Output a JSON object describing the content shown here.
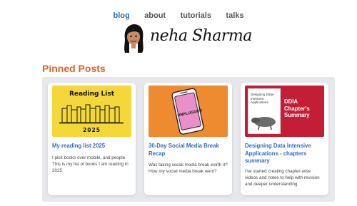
{
  "nav": {
    "items": [
      {
        "label": "blog",
        "active": true
      },
      {
        "label": "about"
      },
      {
        "label": "tutorials"
      },
      {
        "label": "talks"
      }
    ]
  },
  "header": {
    "signature": "neha Sharma"
  },
  "pinned": {
    "title": "Pinned Posts",
    "cards": [
      {
        "title": "My reading list 2025",
        "description": "I pick books over mobile, and people. This is my list of books I am reading in 2025",
        "thumb": {
          "heading": "Reading List",
          "year": "2025"
        }
      },
      {
        "title": "30-Day Social Media Break Recap",
        "description": "Was taking social media break worth it? How my social media break went?",
        "thumb": {
          "label": "UNPLUGGED"
        }
      },
      {
        "title": "Designing Data Intensive Applications - chapters summary",
        "description": "I've started creating chapter-wise videos and notes to help with revision and deeper understanding",
        "thumb": {
          "book_title": "Designing Data-Intensive Applications",
          "overlay": "DDIA Chapter's Summary"
        }
      }
    ]
  },
  "colors": {
    "link": "#2a6dc1",
    "accent": "#e0632a",
    "panel": "#e6e8ec"
  }
}
